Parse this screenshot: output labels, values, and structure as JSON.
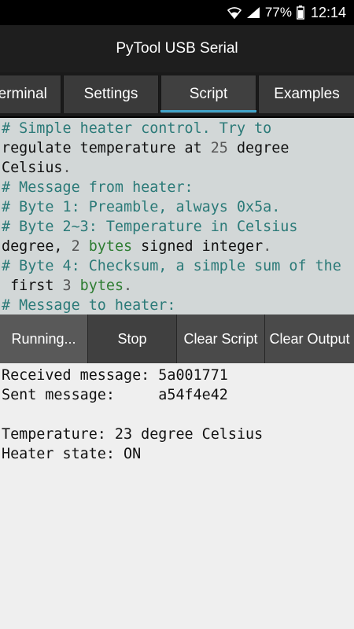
{
  "status_bar": {
    "battery_percent": "77%",
    "time": "12:14",
    "icons": [
      "wifi-icon",
      "signal-icon",
      "battery-icon"
    ]
  },
  "app_bar": {
    "title": "PyTool USB Serial"
  },
  "tabs": [
    {
      "label": "Terminal"
    },
    {
      "label": "Settings"
    },
    {
      "label": "Script",
      "selected": true
    },
    {
      "label": "Examples"
    }
  ],
  "script": {
    "lines": [
      [
        {
          "t": "# Simple heater control. Try to",
          "c": "cmt"
        }
      ],
      [
        {
          "t": "regulate temperature at ",
          "c": ""
        },
        {
          "t": "25",
          "c": "num"
        },
        {
          "t": " degree",
          "c": ""
        }
      ],
      [
        {
          "t": "Celsius",
          "c": ""
        },
        {
          "t": ".",
          "c": "num"
        }
      ],
      [
        {
          "t": "# Message from heater:",
          "c": "cmt"
        }
      ],
      [
        {
          "t": "# Byte 1: Preamble, always 0x5a.",
          "c": "cmt"
        }
      ],
      [
        {
          "t": "# Byte 2~3: Temperature in Celsius",
          "c": "cmt"
        }
      ],
      [
        {
          "t": "degree, ",
          "c": ""
        },
        {
          "t": "2",
          "c": "num"
        },
        {
          "t": " ",
          "c": ""
        },
        {
          "t": "bytes",
          "c": "kw"
        },
        {
          "t": " signed integer",
          "c": ""
        },
        {
          "t": ".",
          "c": "num"
        }
      ],
      [
        {
          "t": "# Byte 4: Checksum, a simple sum of the",
          "c": "cmt"
        }
      ],
      [
        {
          "t": " first ",
          "c": ""
        },
        {
          "t": "3",
          "c": "num"
        },
        {
          "t": " ",
          "c": ""
        },
        {
          "t": "bytes",
          "c": "kw"
        },
        {
          "t": ".",
          "c": "num"
        }
      ],
      [
        {
          "t": "# Message to heater:",
          "c": "cmt"
        }
      ]
    ]
  },
  "buttons": {
    "running": "Running...",
    "stop": "Stop",
    "clear_script": "Clear Script",
    "clear_output": "Clear Output"
  },
  "output": {
    "lines": [
      "Received message: 5a001771",
      "Sent message:     a54f4e42",
      "",
      "Temperature: 23 degree Celsius",
      "Heater state: ON"
    ]
  },
  "colors": {
    "tab_indicator": "#41a3c8",
    "comment": "#2b7a78",
    "keyword": "#2e7d32"
  }
}
